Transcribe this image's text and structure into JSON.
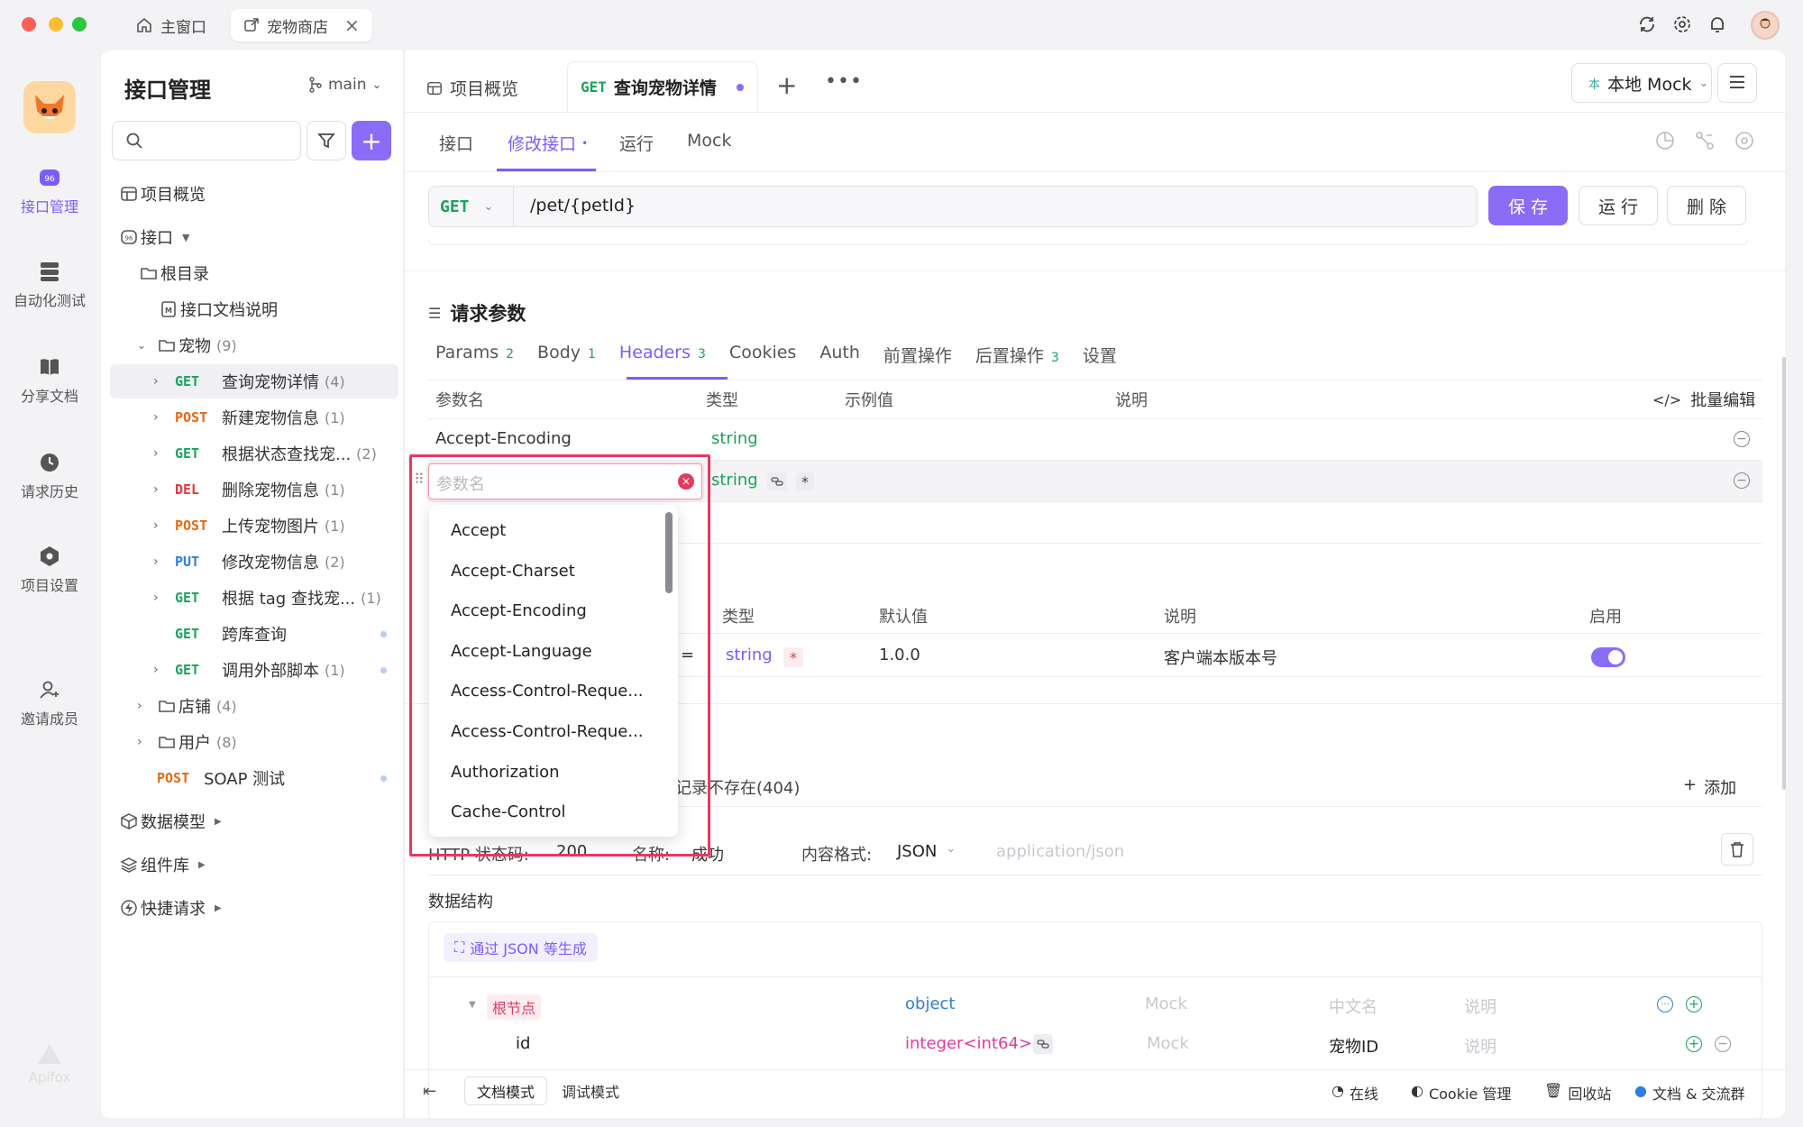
{
  "titlebar": {
    "home_tab": "主窗口",
    "project_tab": "宠物商店"
  },
  "rail": {
    "items": [
      "接口管理",
      "自动化测试",
      "分享文档",
      "请求历史",
      "项目设置",
      "邀请成员"
    ],
    "brand": "Apifox"
  },
  "sidebar": {
    "title": "接口管理",
    "branch": "main",
    "search_placeholder": "",
    "overview": "项目概览",
    "api_group": "接口",
    "root": "根目录",
    "doc": "接口文档说明",
    "pets_folder": "宠物",
    "pets_count": "(9)",
    "apis": [
      {
        "method": "GET",
        "name": "查询宠物详情",
        "count": "(4)"
      },
      {
        "method": "POST",
        "name": "新建宠物信息",
        "count": "(1)"
      },
      {
        "method": "GET",
        "name": "根据状态查找宠...",
        "count": "(2)"
      },
      {
        "method": "DEL",
        "name": "删除宠物信息",
        "count": "(1)"
      },
      {
        "method": "POST",
        "name": "上传宠物图片",
        "count": "(1)"
      },
      {
        "method": "PUT",
        "name": "修改宠物信息",
        "count": "(2)"
      },
      {
        "method": "GET",
        "name": "根据 tag 查找宠...",
        "count": "(1)"
      },
      {
        "method": "GET",
        "name": "跨库查询",
        "count": ""
      },
      {
        "method": "GET",
        "name": "调用外部脚本",
        "count": "(1)"
      }
    ],
    "shop_folder": "店铺",
    "shop_count": "(4)",
    "user_folder": "用户",
    "user_count": "(8)",
    "soap_method": "POST",
    "soap_name": "SOAP 测试",
    "data_model": "数据模型",
    "components": "组件库",
    "quick_request": "快捷请求"
  },
  "main": {
    "tab_overview": "项目概览",
    "tab_active_method": "GET",
    "tab_active_name": "查询宠物详情",
    "env": "本地 Mock",
    "env_badge": "本",
    "subtabs": [
      "接口",
      "修改接口",
      "运行",
      "Mock"
    ],
    "method": "GET",
    "url": "/pet/{petId}",
    "save": "保 存",
    "run": "运 行",
    "delete": "删 除",
    "req_params_title": "请求参数",
    "param_tabs": [
      {
        "label": "Params",
        "badge": "2"
      },
      {
        "label": "Body",
        "badge": "1"
      },
      {
        "label": "Headers",
        "badge": "3"
      },
      {
        "label": "Cookies",
        "badge": ""
      },
      {
        "label": "Auth",
        "badge": ""
      },
      {
        "label": "前置操作",
        "badge": ""
      },
      {
        "label": "后置操作",
        "badge": "3"
      },
      {
        "label": "设置",
        "badge": ""
      }
    ],
    "headers_cols": [
      "参数名",
      "类型",
      "示例值",
      "说明"
    ],
    "bulk_edit": "批量编辑",
    "header_row1_name": "Accept-Encoding",
    "header_row1_type": "string",
    "input_placeholder": "参数名",
    "header_row2_type": "string",
    "header_row2_required": "*",
    "dropdown": [
      "Accept",
      "Accept-Charset",
      "Accept-Encoding",
      "Accept-Language",
      "Access-Control-Reque...",
      "Access-Control-Reque...",
      "Authorization",
      "Cache-Control"
    ],
    "global_cols": [
      "类型",
      "默认值",
      "说明",
      "启用"
    ],
    "global_row_eq": "=",
    "global_row_type": "string",
    "global_row_required": "*",
    "global_row_default": "1.0.0",
    "global_row_desc": "客户端本版本号",
    "global_row_enabled": true,
    "resp_tab_tail": "记录不存在(404)",
    "add": "添加",
    "resp_status_label": "HTTP 状态码:",
    "resp_status": "200",
    "resp_name_label": "名称:",
    "resp_name": "成功",
    "content_format_label": "内容格式:",
    "content_format": "JSON",
    "content_type_placeholder": "application/json",
    "data_structure": "数据结构",
    "gen_from_json": "通过 JSON 等生成",
    "schema_rows": [
      {
        "name": "根节点",
        "type": "object",
        "mock": "Mock",
        "cn": "中文名",
        "desc": "说明"
      },
      {
        "name": "id",
        "type": "integer<int64>",
        "mock": "Mock",
        "cn": "宠物ID",
        "desc": "说明"
      }
    ]
  },
  "footer": {
    "doc_mode": "文档模式",
    "debug_mode": "调试模式",
    "online": "在线",
    "cookie": "Cookie 管理",
    "trash": "回收站",
    "community": "文档 & 交流群"
  },
  "colors": {
    "accent": "#7c5cff",
    "get": "#1aa35b",
    "post": "#e8670b",
    "del": "#e6373d",
    "put": "#2f7ddc",
    "highlight": "#e8385f"
  }
}
